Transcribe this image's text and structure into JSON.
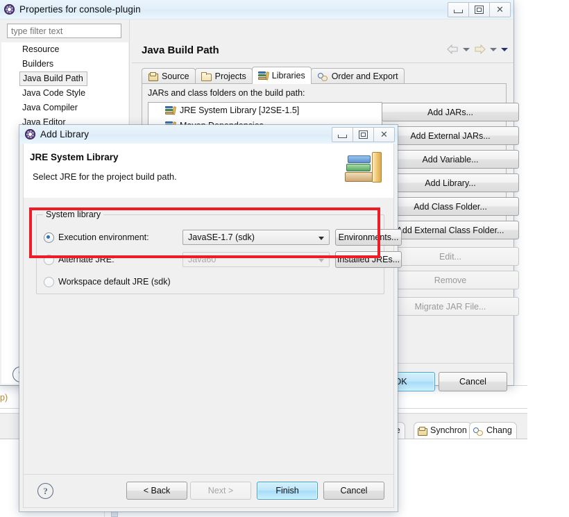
{
  "properties_dialog": {
    "title": "Properties for console-plugin",
    "icon": "eclipse-icon",
    "window_controls": {
      "minimize": "minimize-icon",
      "maximize": "maximize-icon",
      "close": "close-icon"
    },
    "filter": {
      "placeholder": "type filter text",
      "value": ""
    },
    "tree_items": [
      {
        "label": "Resource",
        "selected": false
      },
      {
        "label": "Builders",
        "selected": false
      },
      {
        "label": "Java Build Path",
        "selected": true
      },
      {
        "label": "Java Code Style",
        "selected": false
      },
      {
        "label": "Java Compiler",
        "selected": false
      },
      {
        "label": "Java Editor",
        "selected": false
      }
    ],
    "page_title": "Java Build Path",
    "nav": {
      "back": "back-arrow-icon",
      "back_menu": "chevron-down-icon",
      "forward": "forward-arrow-icon",
      "forward_menu": "chevron-down-icon",
      "view_menu": "chevron-down-icon"
    },
    "tabs": [
      {
        "label": "Source",
        "icon": "source-folder-icon",
        "active": false
      },
      {
        "label": "Projects",
        "icon": "folder-icon",
        "active": false
      },
      {
        "label": "Libraries",
        "icon": "books-icon",
        "active": true
      },
      {
        "label": "Order and Export",
        "icon": "order-export-icon",
        "active": false
      }
    ],
    "libraries_tab": {
      "list_label": "JARs and class folders on the build path:",
      "entries": [
        {
          "label": "JRE System Library [J2SE-1.5]",
          "icon": "books-icon"
        },
        {
          "label": "Maven Dependencies",
          "icon": "books-icon"
        }
      ],
      "buttons": [
        {
          "label": "Add JARs...",
          "enabled": true
        },
        {
          "label": "Add External JARs...",
          "enabled": true
        },
        {
          "label": "Add Variable...",
          "enabled": true
        },
        {
          "label": "Add Library...",
          "enabled": true
        },
        {
          "label": "Add Class Folder...",
          "enabled": true
        },
        {
          "label": "Add External Class Folder...",
          "enabled": true
        },
        {
          "label": "Edit...",
          "enabled": false
        },
        {
          "label": "Remove",
          "enabled": false
        },
        {
          "label": "Migrate JAR File...",
          "enabled": false
        }
      ]
    },
    "help_icon": "help-question-icon",
    "ok_label": "OK",
    "cancel_label": "Cancel"
  },
  "add_library_dialog": {
    "title": "Add Library",
    "icon": "eclipse-icon",
    "window_controls": {
      "minimize": "minimize-icon",
      "maximize": "maximize-icon",
      "close": "close-icon"
    },
    "header_title": "JRE System Library",
    "header_subtitle": "Select JRE for the project build path.",
    "header_icon": "books-stack-icon",
    "group": {
      "legend": "System library",
      "highlight_color": "#ee1c26",
      "options": [
        {
          "id": "execution-environment",
          "label": "Execution environment:",
          "selected": true,
          "combo_value": "JavaSE-1.7 (sdk)",
          "combo_enabled": true,
          "button": "Environments...",
          "button_enabled": true
        },
        {
          "id": "alternate-jre",
          "label": "Alternate JRE:",
          "selected": false,
          "combo_value": "Java60",
          "combo_enabled": false,
          "button": "Installed JREs...",
          "button_enabled": true
        },
        {
          "id": "workspace-default-jre",
          "label": "Workspace default JRE (sdk)",
          "selected": false
        }
      ]
    },
    "help_icon": "help-question-icon",
    "buttons": [
      {
        "label": "< Back",
        "enabled": true,
        "primary": false
      },
      {
        "label": "Next >",
        "enabled": false,
        "primary": false
      },
      {
        "label": "Finish",
        "enabled": true,
        "primary": true
      },
      {
        "label": "Cancel",
        "enabled": true,
        "primary": false
      }
    ]
  },
  "background_ide": {
    "view_tabs": [
      {
        "label": "ole",
        "icon": "console-icon",
        "partial": true
      },
      {
        "label": "Synchron",
        "icon": "synchronize-icon",
        "partial": false
      },
      {
        "label": "Chang",
        "icon": "change-sets-icon",
        "partial": false
      }
    ],
    "text_fragment": "p)",
    "scrollbar_down": "scroll-down-arrow-icon"
  }
}
